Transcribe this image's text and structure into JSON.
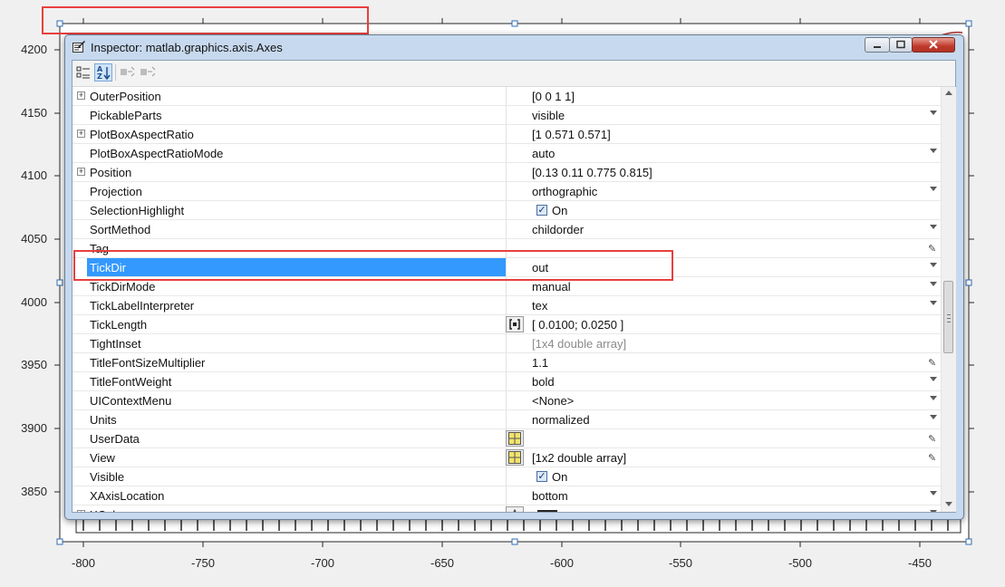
{
  "figure": {
    "y_ticks": [
      "4200",
      "4150",
      "4100",
      "4050",
      "4000",
      "3950",
      "3900",
      "3850"
    ],
    "x_ticks": [
      "-800",
      "-750",
      "-700",
      "-650",
      "-600",
      "-550",
      "-500",
      "-450"
    ]
  },
  "inspector": {
    "title": "Inspector:  matlab.graphics.axis.Axes",
    "toolbar": {
      "categorized_icon": "categorized-view-icon",
      "alphabetical_icon": "alphabetical-sort-icon",
      "expand_icon": "expand-all-icon",
      "collapse_icon": "collapse-all-icon"
    },
    "properties": [
      {
        "name": "OuterPosition",
        "value": "[0 0 1 1]",
        "expandable": true,
        "control": "none"
      },
      {
        "name": "PickableParts",
        "value": "visible",
        "control": "dropdown"
      },
      {
        "name": "PlotBoxAspectRatio",
        "value": "[1 0.571 0.571]",
        "expandable": true,
        "control": "none"
      },
      {
        "name": "PlotBoxAspectRatioMode",
        "value": "auto",
        "control": "dropdown"
      },
      {
        "name": "Position",
        "value": "[0.13 0.11 0.775 0.815]",
        "expandable": true,
        "control": "none"
      },
      {
        "name": "Projection",
        "value": "orthographic",
        "control": "dropdown"
      },
      {
        "name": "SelectionHighlight",
        "value": "On",
        "control": "checkbox",
        "checked": true
      },
      {
        "name": "SortMethod",
        "value": "childorder",
        "control": "dropdown"
      },
      {
        "name": "Tag",
        "value": "",
        "control": "pencil"
      },
      {
        "name": "TickDir",
        "value": "out",
        "control": "dropdown",
        "selected": true
      },
      {
        "name": "TickDirMode",
        "value": "manual",
        "control": "dropdown"
      },
      {
        "name": "TickLabelInterpreter",
        "value": "tex",
        "control": "dropdown"
      },
      {
        "name": "TickLength",
        "value": "[ 0.0100; 0.0250 ]",
        "control": "none",
        "editor": "matrix"
      },
      {
        "name": "TightInset",
        "value": "[1x4  double array]",
        "control": "none",
        "muted": true
      },
      {
        "name": "TitleFontSizeMultiplier",
        "value": "1.1",
        "control": "pencil"
      },
      {
        "name": "TitleFontWeight",
        "value": "bold",
        "control": "dropdown"
      },
      {
        "name": "UIContextMenu",
        "value": "<None>",
        "control": "dropdown"
      },
      {
        "name": "Units",
        "value": "normalized",
        "control": "dropdown"
      },
      {
        "name": "UserData",
        "value": "",
        "control": "pencil",
        "editor": "grid"
      },
      {
        "name": "View",
        "value": "[1x2  double array]",
        "control": "pencil",
        "editor": "grid"
      },
      {
        "name": "Visible",
        "value": "On",
        "control": "checkbox",
        "checked": true
      },
      {
        "name": "XAxisLocation",
        "value": "bottom",
        "control": "dropdown"
      },
      {
        "name": "XColor",
        "value": "",
        "expandable": true,
        "control": "dropdown",
        "editor": "palette",
        "swatch": "#262626"
      }
    ]
  }
}
